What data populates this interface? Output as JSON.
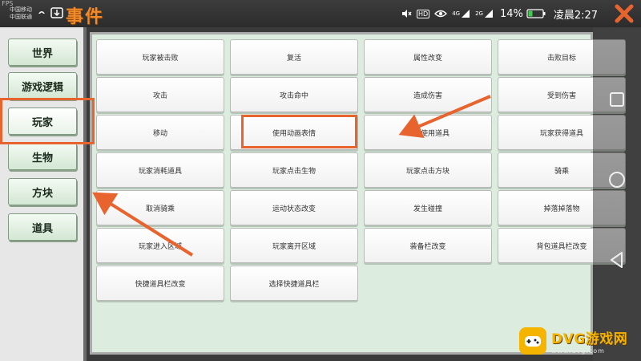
{
  "status_bar": {
    "fps": "FPS",
    "carrier_lines": [
      "中国移动",
      "中国联通"
    ],
    "network_hd": "HD",
    "signal_4g": "4G",
    "signal_2g": "2G",
    "battery_percent": "14%",
    "time": "凌晨2:27"
  },
  "title": "事件",
  "categories": [
    {
      "label": "世界"
    },
    {
      "label": "游戏逻辑"
    },
    {
      "label": "玩家"
    },
    {
      "label": "生物"
    },
    {
      "label": "方块"
    },
    {
      "label": "道具"
    }
  ],
  "events": [
    "玩家被击败",
    "复活",
    "属性改变",
    "击败目标",
    "攻击",
    "攻击命中",
    "造成伤害",
    "受到伤害",
    "移动",
    "使用动画表情",
    "玩家使用道具",
    "玩家获得道具",
    "玩家消耗道具",
    "玩家点击生物",
    "玩家点击方块",
    "骑乘",
    "取消骑乘",
    "运动状态改变",
    "发生碰撞",
    "掉落掉落物",
    "玩家进入区域",
    "玩家离开区域",
    "装备栏改变",
    "背包道具栏改变",
    "快捷道具栏改变",
    "选择快捷道具栏"
  ],
  "watermark": {
    "name": "DVG游戏网",
    "url": "www.dvg.com"
  },
  "colors": {
    "title": "#f08a2a",
    "highlight": "#e8642e",
    "category_button": "#dcebdc",
    "panel_background": "#dcede0",
    "watermark": "#f4b400"
  },
  "icons": [
    "close-icon",
    "back-icon",
    "home-icon",
    "recent-apps-icon",
    "watermark-logo-icon"
  ]
}
